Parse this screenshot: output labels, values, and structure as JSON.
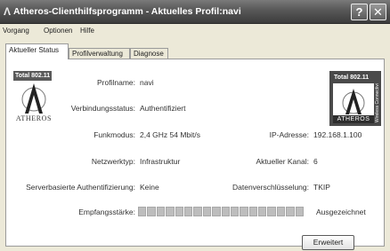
{
  "window": {
    "title": "Atheros-Clienthilfsprogramm - Aktuelles Profil:navi",
    "title_icon": "atheros-a-icon",
    "help_glyph": "?",
    "close_glyph": "✕"
  },
  "menu": {
    "items": [
      {
        "label": "Vorgang"
      },
      {
        "label": "Optionen"
      },
      {
        "label": "Hilfe"
      }
    ]
  },
  "tabs": [
    {
      "label": "Aktueller Status",
      "active": true
    },
    {
      "label": "Profilverwaltung",
      "active": false
    },
    {
      "label": "Diagnose",
      "active": false
    }
  ],
  "logo_left": {
    "badge": "Total 802.11",
    "word": "ATHEROS"
  },
  "logo_right": {
    "badge": "Total 802.11",
    "word": "ATHEROS",
    "side": "Wireless Connectivity"
  },
  "status": {
    "profile_label": "Profilname:",
    "profile_value": "navi",
    "connection_label": "Verbindungsstatus:",
    "connection_value": "Authentifiziert",
    "radio_label": "Funkmodus:",
    "radio_value": "2,4 GHz 54 Mbit/s",
    "ip_label": "IP-Adresse:",
    "ip_value": "192.168.1.100",
    "network_label": "Netzwerktyp:",
    "network_value": "Infrastruktur",
    "channel_label": "Aktueller Kanal:",
    "channel_value": "6",
    "server_auth_label": "Serverbasierte Authentifizierung:",
    "server_auth_value": "Keine",
    "encryption_label": "Datenverschlüsselung:",
    "encryption_value": "TKIP",
    "signal_label": "Empfangsstärke:",
    "signal_value": "Ausgezeichnet",
    "signal_level_fraction": 1.0
  },
  "buttons": {
    "advanced": "Erweitert"
  }
}
